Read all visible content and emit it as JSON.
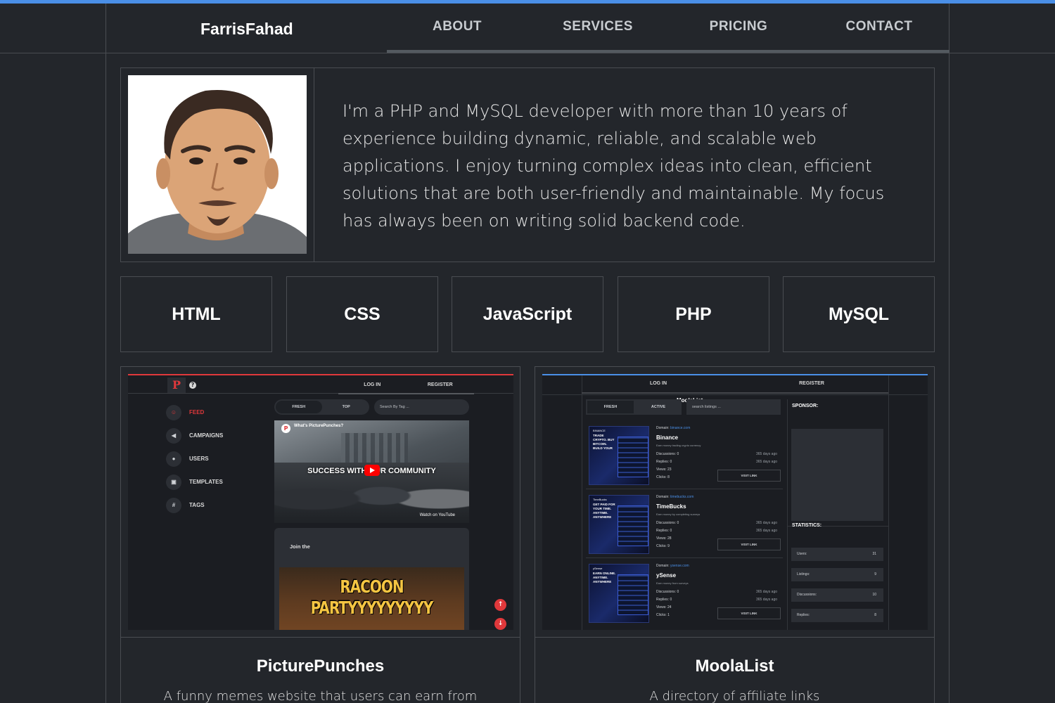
{
  "colors": {
    "accent_top": "#4a8fe7",
    "background": "#23262b",
    "border": "#4a4d52",
    "pp_red": "#e0383b"
  },
  "nav": {
    "brand": "FarrisFahad",
    "items": [
      "ABOUT",
      "SERVICES",
      "PRICING",
      "CONTACT"
    ]
  },
  "about": {
    "avatar_alt": "cartoon-portrait",
    "text": "I'm a PHP and MySQL developer with more than 10 years of experience building dynamic, reliable, and scalable web applications. I enjoy turning complex ideas into clean, efficient solutions that are both user-friendly and maintainable. My focus has always been on writing solid backend code."
  },
  "skills": [
    "HTML",
    "CSS",
    "JavaScript",
    "PHP",
    "MySQL"
  ],
  "projects": [
    {
      "title": "PicturePunches",
      "description": "A funny memes website that users can earn from",
      "preview": {
        "logo": "P",
        "help": "?",
        "tabs": [
          "LOG IN",
          "REGISTER"
        ],
        "sidebar": [
          {
            "icon": "smile-icon",
            "glyph": "☺",
            "label": "FEED"
          },
          {
            "icon": "megaphone-icon",
            "glyph": "📢",
            "label": "CAMPAIGNS"
          },
          {
            "icon": "user-icon",
            "glyph": "👤",
            "label": "USERS"
          },
          {
            "icon": "image-icon",
            "glyph": "▣",
            "label": "TEMPLATES"
          },
          {
            "icon": "hash-icon",
            "glyph": "#",
            "label": "TAGS"
          }
        ],
        "filters": [
          "FRESH",
          "TOP"
        ],
        "search_placeholder": "Search By Tag ...",
        "video_title": "What's PicturePunches?",
        "video_caption": "SUCCESS WITH OUR COMMUNITY",
        "video_source": "Watch on YouTube",
        "post_title": "Join the",
        "meme_text": "RACOON PARTYYYYYYYYY",
        "up": "↑",
        "down": "↓"
      }
    },
    {
      "title": "MoolaList",
      "description": "A directory of affiliate links",
      "preview": {
        "tabs": [
          "MoolaList",
          "LOG IN",
          "REGISTER"
        ],
        "filters": [
          "FRESH",
          "ACTIVE"
        ],
        "search_placeholder": "search listings ...",
        "labels": {
          "domain": "Domain:",
          "discussions": "Discussions:",
          "replies": "Replies:",
          "views": "Views:",
          "clicks": "Clicks:",
          "visit": "VISIT LINK"
        },
        "listings": [
          {
            "thumb_small": "BINANCE",
            "thumb_text": "TRADE CRYPTO. BUY BITCOIN. BUILD YOUR",
            "domain": "binance.com",
            "name": "Binance",
            "sub": "Earn money trading crypto currency",
            "discussions": "0",
            "replies": "0",
            "views": "23",
            "clicks": "8",
            "ago1": "365 days ago",
            "ago2": "365 days ago"
          },
          {
            "thumb_small": "TimeBucks",
            "thumb_text": "GET PAID FOR YOUR TIME. ANYTIME. ANYWHERE",
            "domain": "timebucks.com",
            "name": "TimeBucks",
            "sub": "Earn money by completing surveys",
            "discussions": "0",
            "replies": "0",
            "views": "28",
            "clicks": "9",
            "ago1": "365 days ago",
            "ago2": "365 days ago"
          },
          {
            "thumb_small": "ySense",
            "thumb_text": "EARN ONLINE. ANYTIME. ANYWHERE",
            "domain": "ysense.com",
            "name": "ySense",
            "sub": "Earn money from surveys",
            "discussions": "0",
            "replies": "0",
            "views": "24",
            "clicks": "1",
            "ago1": "365 days ago",
            "ago2": "365 days ago"
          }
        ],
        "sponsor_title": "SPONSOR:",
        "statistics_title": "STATISTICS:",
        "stats": [
          {
            "label": "Users:",
            "value": "31"
          },
          {
            "label": "Listings:",
            "value": "9"
          },
          {
            "label": "Discussions:",
            "value": "10"
          },
          {
            "label": "Replies:",
            "value": "8"
          }
        ]
      }
    }
  ]
}
